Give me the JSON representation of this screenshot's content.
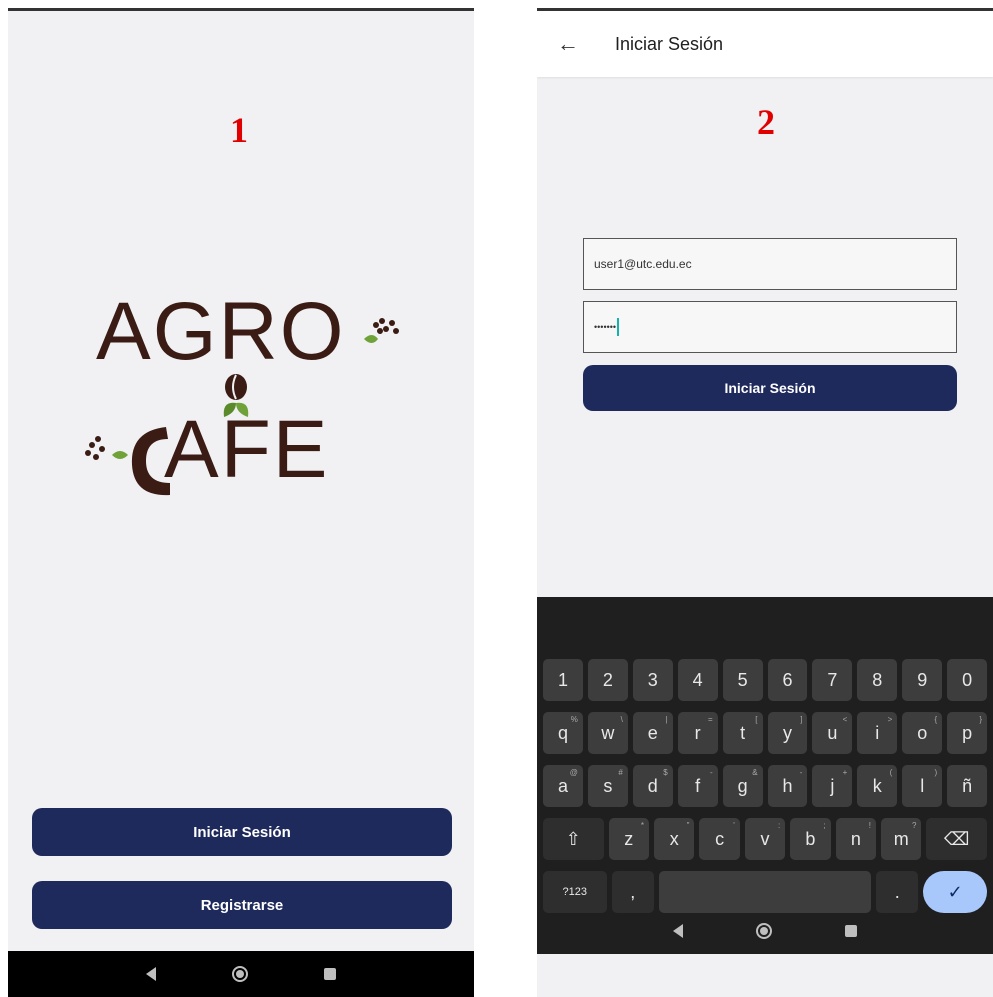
{
  "screen1": {
    "number": "1",
    "logo": {
      "line1": "AGRO",
      "line2": "AFE"
    },
    "buttons": {
      "login": "Iniciar Sesión",
      "register": "Registrarse"
    }
  },
  "screen2": {
    "number": "2",
    "appbar": {
      "back_icon": "←",
      "title": "Iniciar Sesión"
    },
    "form": {
      "email_value": "user1@utc.edu.ec",
      "password_value": "•••••••",
      "login_button": "Iniciar Sesión"
    },
    "keyboard": {
      "row1": [
        "1",
        "2",
        "3",
        "4",
        "5",
        "6",
        "7",
        "8",
        "9",
        "0"
      ],
      "row2": [
        [
          "q",
          "%"
        ],
        [
          "w",
          "\\"
        ],
        [
          "e",
          "|"
        ],
        [
          "r",
          "="
        ],
        [
          "t",
          "["
        ],
        [
          "y",
          "]"
        ],
        [
          "u",
          "<"
        ],
        [
          "i",
          ">"
        ],
        [
          "o",
          "{"
        ],
        [
          "p",
          "}"
        ]
      ],
      "row3": [
        [
          "a",
          "@"
        ],
        [
          "s",
          "#"
        ],
        [
          "d",
          "$"
        ],
        [
          "f",
          "-"
        ],
        [
          "g",
          "&"
        ],
        [
          "h",
          "-"
        ],
        [
          "j",
          "+"
        ],
        [
          "k",
          "("
        ],
        [
          "l",
          ")"
        ],
        [
          "ñ",
          ""
        ]
      ],
      "row4": [
        [
          "z",
          "*"
        ],
        [
          "x",
          "\""
        ],
        [
          "c",
          "'"
        ],
        [
          "v",
          ":"
        ],
        [
          "b",
          ";"
        ],
        [
          "n",
          "!"
        ],
        [
          "m",
          "?"
        ]
      ],
      "symbols_key": "?123",
      "comma_key": ",",
      "period_key": ".",
      "shift_icon": "⇧",
      "backspace_icon": "⌫",
      "enter_icon": "✓"
    }
  },
  "colors": {
    "primary": "#1f2a5c",
    "background": "#f1f1f3",
    "logo": "#3a1c14",
    "accent_red": "#e00000"
  }
}
